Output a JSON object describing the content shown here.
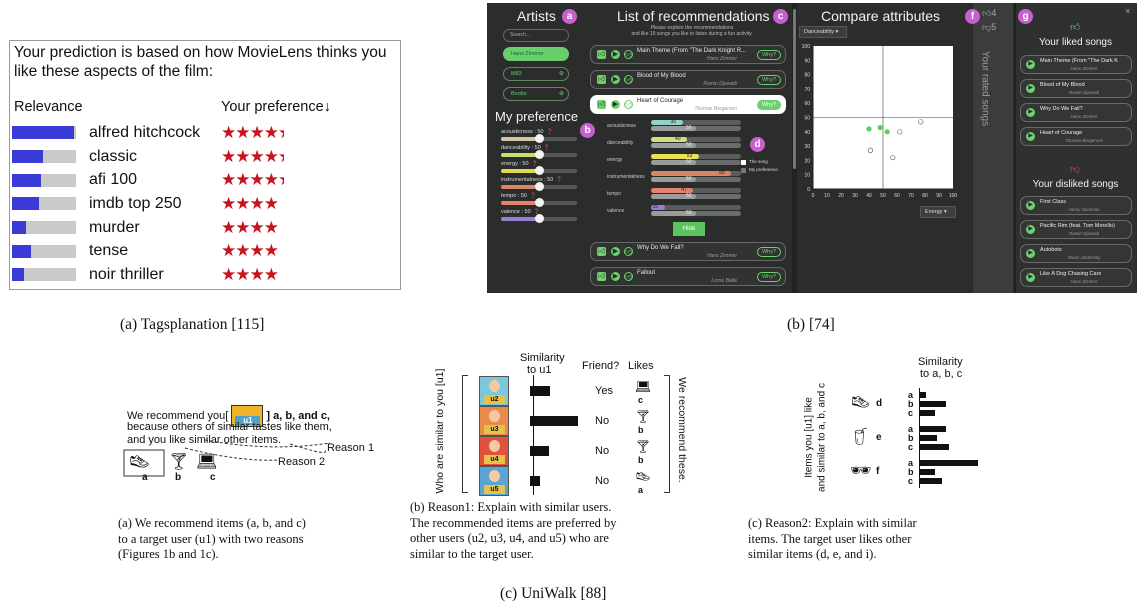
{
  "panel_a": {
    "intro": "Your prediction is based on how MovieLens thinks you like these aspects of the film:",
    "relevance_header": "Relevance",
    "preference_header": "Your preference",
    "sort_arrow": "↓",
    "rows": [
      {
        "tag": "alfred hitchcock",
        "relevance": 0.97,
        "stars": "★★★★",
        "half": "★"
      },
      {
        "tag": "classic",
        "relevance": 0.48,
        "stars": "★★★★",
        "half": "★"
      },
      {
        "tag": "afi 100",
        "relevance": 0.46,
        "stars": "★★★★",
        "half": "★"
      },
      {
        "tag": "imdb top 250",
        "relevance": 0.42,
        "stars": "★★★★",
        "half": ""
      },
      {
        "tag": "murder",
        "relevance": 0.22,
        "stars": "★★★★",
        "half": ""
      },
      {
        "tag": "tense",
        "relevance": 0.3,
        "stars": "★★★★",
        "half": ""
      },
      {
        "tag": "noir thriller",
        "relevance": 0.19,
        "stars": "★★★★",
        "half": ""
      }
    ],
    "caption": "(a) Tagsplanation [115]"
  },
  "panel_b": {
    "colors": {
      "bg": "#2b2d2c",
      "accent": "#67d06c",
      "badge": "#c95fcf"
    },
    "artists_title": "Artists",
    "badge_a": "a",
    "search_placeholder": "Search...",
    "artist_chips": [
      {
        "label": "Hans Zimmer",
        "selected": true
      },
      {
        "label": "M83",
        "selected": false
      },
      {
        "label": "Boobs",
        "selected": false
      }
    ],
    "my_pref_title": "My preference",
    "badge_b": "b",
    "preferences": [
      {
        "label": "acousticness : 50",
        "value": 0.5,
        "color": "#d8c6a0"
      },
      {
        "label": "danceability : 50",
        "value": 0.5,
        "color": "#c7df6d"
      },
      {
        "label": "energy : 50",
        "value": 0.5,
        "color": "#e1d94e"
      },
      {
        "label": "instrumentalness : 50",
        "value": 0.5,
        "color": "#d98566"
      },
      {
        "label": "tempo : 50",
        "value": 0.5,
        "color": "#e3826f"
      },
      {
        "label": "valence : 50",
        "value": 0.5,
        "color": "#9a7ed1"
      }
    ],
    "rec_title": "List of recommendations",
    "badge_c": "c",
    "rec_subtitle_1": "Please explore the recommendations",
    "rec_subtitle_2": "and like 15 songs you like to listen during a fun activity.",
    "songs": [
      {
        "title": "Main Theme (From \"The Dark Knight R...",
        "artist": "Hans Zimmer",
        "why": "Why?"
      },
      {
        "title": "Blood of My Blood",
        "artist": "Ramin Djawadi",
        "why": "Why?"
      },
      {
        "title": "Heart of Courage",
        "artist": "Thomas Bergersen",
        "why": "Why?"
      },
      {
        "title": "Why Do We Fall?",
        "artist": "Hans Zimmer",
        "why": "Why?"
      },
      {
        "title": "Fallout",
        "artist": "Lorne Balfe",
        "why": "Why?"
      }
    ],
    "badge_d": "d",
    "attributes": [
      {
        "name": "acousticness",
        "song": "35",
        "pref": "50"
      },
      {
        "name": "danceability",
        "song": "40",
        "pref": "50"
      },
      {
        "name": "energy",
        "song": "53",
        "pref": "50"
      },
      {
        "name": "instrumentalness",
        "song": "89",
        "pref": "50"
      },
      {
        "name": "tempo",
        "song": "47",
        "pref": "50"
      },
      {
        "name": "valence",
        "song": "15",
        "pref": "50"
      }
    ],
    "legend_song": "The song",
    "legend_pref": "My preference",
    "hide_label": "Hide",
    "compare_title": "Compare attributes",
    "badge_e": "e",
    "badge_f": "f",
    "dropdown_x": "Danceability",
    "dropdown_y": "Energy",
    "like_count": "4",
    "dislike_count": "5",
    "rated_label": "Your rated songs",
    "scatter": {
      "x_ticks": [
        "0",
        "10",
        "20",
        "30",
        "40",
        "50",
        "60",
        "70",
        "80",
        "90",
        "100"
      ],
      "y_ticks": [
        "0",
        "10",
        "20",
        "30",
        "40",
        "50",
        "60",
        "70",
        "80",
        "90",
        "100"
      ],
      "points": [
        {
          "x": 40,
          "y": 42,
          "liked": true
        },
        {
          "x": 48,
          "y": 43,
          "liked": true
        },
        {
          "x": 53,
          "y": 40,
          "liked": true
        },
        {
          "x": 41,
          "y": 27,
          "liked": true
        },
        {
          "x": 62,
          "y": 40,
          "liked": false
        },
        {
          "x": 77,
          "y": 47,
          "liked": false
        },
        {
          "x": 57,
          "y": 22,
          "liked": false
        },
        {
          "x": 41,
          "y": 27,
          "liked": false
        }
      ]
    },
    "badge_g": "g",
    "close": "×",
    "liked_title": "Your liked songs",
    "liked": [
      {
        "title": "Main Theme (From \"The Dark K",
        "artist": "Hans Zimmer"
      },
      {
        "title": "Blood of My Blood",
        "artist": "Ramin Djawadi"
      },
      {
        "title": "Why Do We Fall?",
        "artist": "Hans Zimmer"
      },
      {
        "title": "Heart of Courage",
        "artist": "Thomas Bergersen"
      }
    ],
    "disliked_title": "Your disliked songs",
    "disliked": [
      {
        "title": "First Class",
        "artist": "Henry Jackman"
      },
      {
        "title": "Pacific Rim (feat. Tom Morello)",
        "artist": "Ramin Djawadi"
      },
      {
        "title": "Autobots",
        "artist": "Steve Jablonsky"
      },
      {
        "title": "Like A Dog Chasing Cars",
        "artist": "Hans Zimmer"
      }
    ],
    "caption": "(b) [74]"
  },
  "panel_c": {
    "sentence_1a": "We recommend you[",
    "sentence_1b": "] a, b, and c,",
    "u1": "u1",
    "sentence_2": "because others of similar tastes like them,",
    "sentence_3": "and you like similar other items.",
    "reason1": "Reason 1",
    "reason2": "Reason 2",
    "items_abc": [
      "a",
      "b",
      "c"
    ],
    "cap1": [
      "(a) We recommend items (a, b, and c)",
      "to a target user (u1) with two reasons",
      "(Figures 1b and 1c)."
    ],
    "fig2": {
      "y_label": "Who are similar to you [u1]",
      "col_sim": "Similarity",
      "col_sim2": "to u1",
      "col_friend": "Friend?",
      "col_likes": "Likes",
      "side_label": "We recommend these.",
      "users": [
        {
          "name": "u2",
          "sim": 0.4,
          "friend": "Yes",
          "item": "c"
        },
        {
          "name": "u3",
          "sim": 0.95,
          "friend": "No",
          "item": "b"
        },
        {
          "name": "u4",
          "sim": 0.38,
          "friend": "No",
          "item": "b"
        },
        {
          "name": "u5",
          "sim": 0.2,
          "friend": "No",
          "item": "a"
        }
      ]
    },
    "cap2": [
      "(b) Reason1:  Explain with similar users.",
      "The recommended items are preferred by",
      "other users (u2, u3, u4, and u5) who are",
      "similar to the target user."
    ],
    "fig3": {
      "y_label_1": "Items you [u1] like",
      "y_label_2": "and similar to a, b, and c",
      "col_sim": "Similarity",
      "col_sim2": "to a, b, c",
      "groups": [
        {
          "item": "d",
          "rows": [
            {
              "l": "a",
              "v": 0.1
            },
            {
              "l": "b",
              "v": 0.45
            },
            {
              "l": "c",
              "v": 0.25
            }
          ]
        },
        {
          "item": "e",
          "rows": [
            {
              "l": "a",
              "v": 0.45
            },
            {
              "l": "b",
              "v": 0.3
            },
            {
              "l": "c",
              "v": 0.5
            }
          ]
        },
        {
          "item": "f",
          "rows": [
            {
              "l": "a",
              "v": 1.0
            },
            {
              "l": "b",
              "v": 0.25
            },
            {
              "l": "c",
              "v": 0.38
            }
          ]
        }
      ]
    },
    "cap3": [
      "(c)  Reason2:  Explain with similar",
      "items.  The target user likes other",
      "similar items (d, e, and i)."
    ],
    "caption": "(c) UniWalk [88]"
  }
}
